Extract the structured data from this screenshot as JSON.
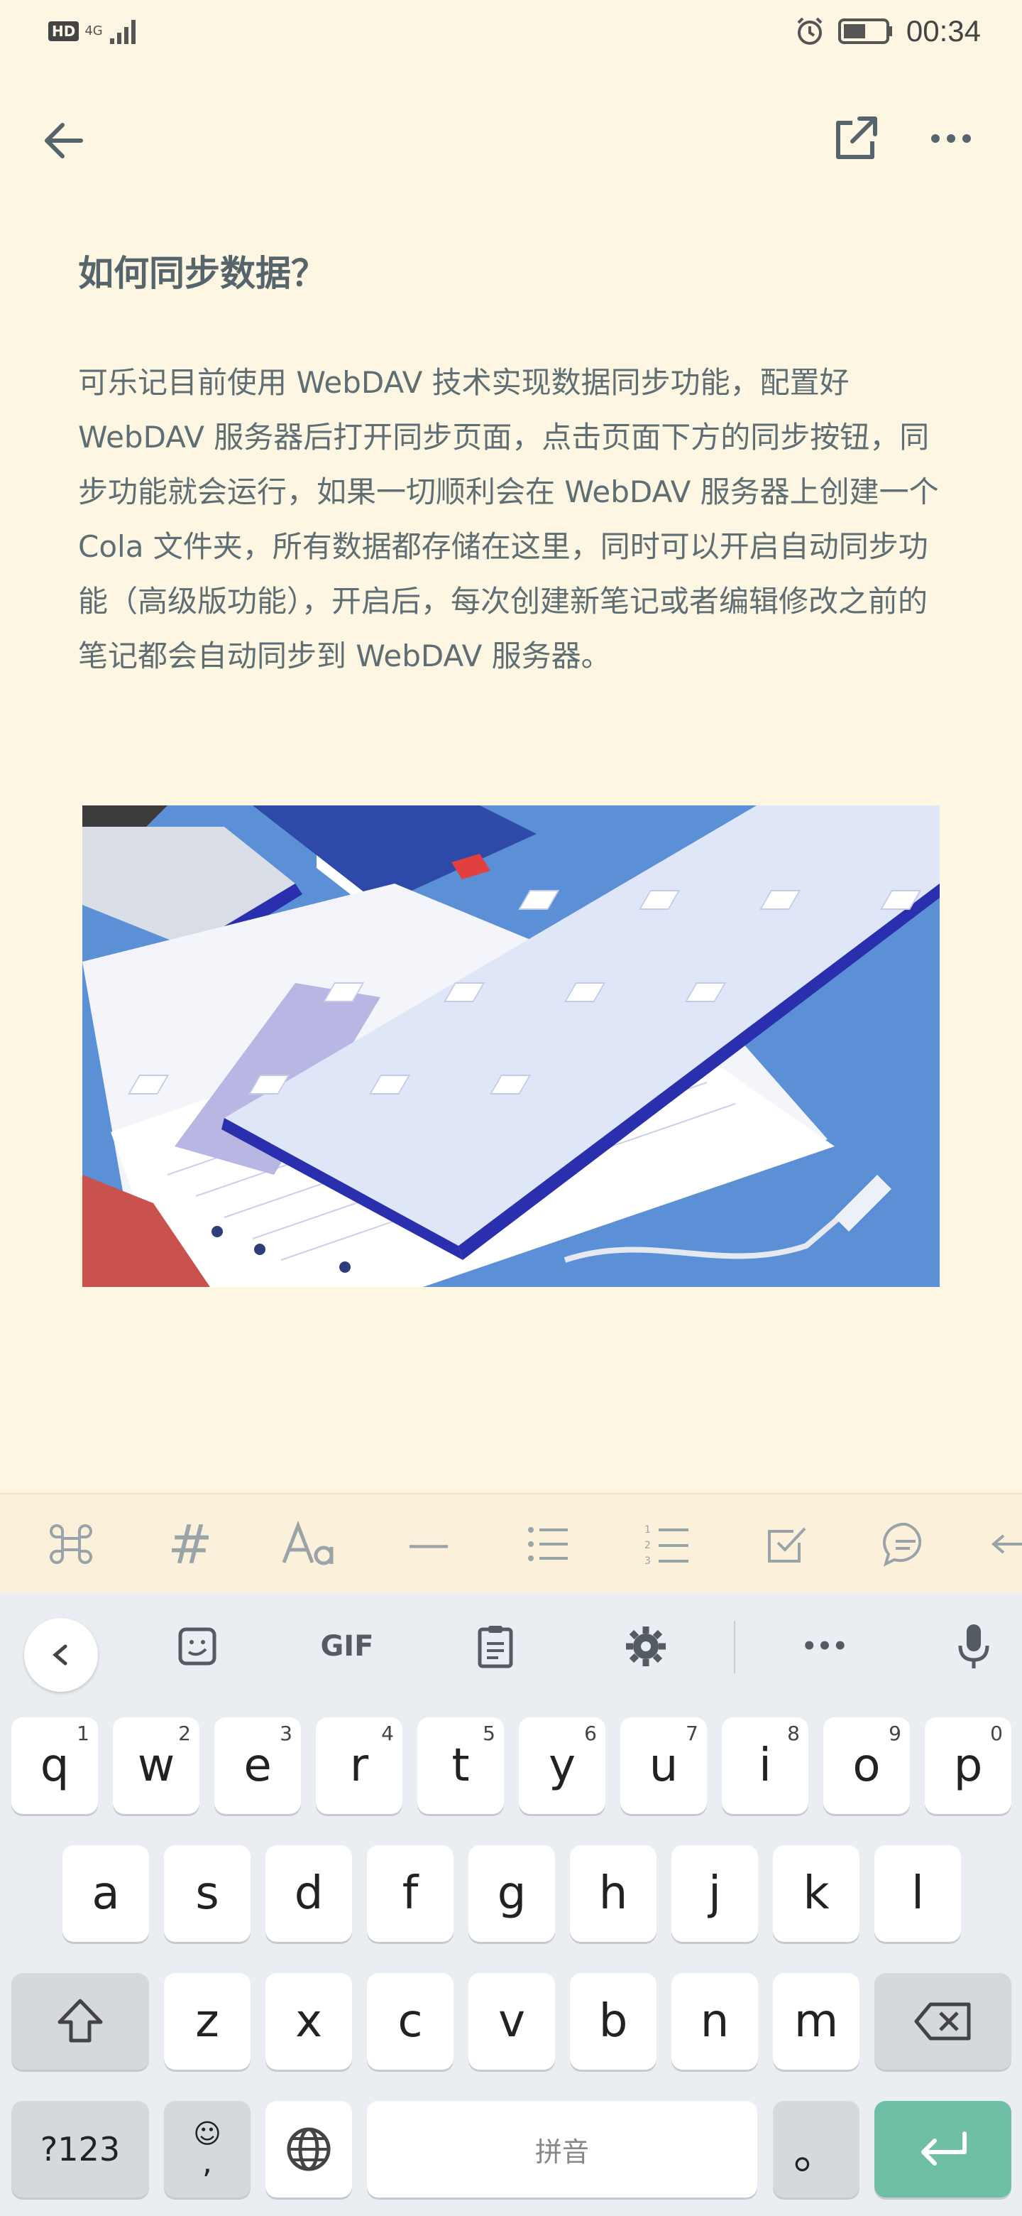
{
  "status_bar": {
    "left_badge": "HD",
    "network": "4G",
    "time": "00:34"
  },
  "note": {
    "title": "如何同步数据？",
    "body": "可乐记目前使用 WebDAV 技术实现数据同步功能，配置好 WebDAV 服务器后打开同步页面，点击页面下方的同步按钮，同步功能就会运行，如果一切顺利会在 WebDAV 服务器上创建一个 Cola 文件夹，所有数据都存储在这里，同时可以开启自动同步功能（高级版功能），开启后，每次创建新笔记或者编辑修改之前的笔记都会自动同步到 WebDAV 服务器。",
    "image_alt": "Illustration of a keyboard on a desk with notes"
  },
  "markdown_toolbar": {
    "tools": [
      "command-icon",
      "heading-icon",
      "text-format-icon",
      "divider-icon",
      "bullet-list-icon",
      "numbered-list-icon",
      "checkbox-icon",
      "quote-icon",
      "more-tools-icon"
    ],
    "heading_glyph": "#",
    "divider_glyph": "—"
  },
  "keyboard": {
    "toolbar": {
      "gif_label": "GIF",
      "more_label": "•••"
    },
    "row1": [
      {
        "label": "q",
        "num": "1"
      },
      {
        "label": "w",
        "num": "2"
      },
      {
        "label": "e",
        "num": "3"
      },
      {
        "label": "r",
        "num": "4"
      },
      {
        "label": "t",
        "num": "5"
      },
      {
        "label": "y",
        "num": "6"
      },
      {
        "label": "u",
        "num": "7"
      },
      {
        "label": "i",
        "num": "8"
      },
      {
        "label": "o",
        "num": "9"
      },
      {
        "label": "p",
        "num": "0"
      }
    ],
    "row2": [
      "a",
      "s",
      "d",
      "f",
      "g",
      "h",
      "j",
      "k",
      "l"
    ],
    "row3": [
      "z",
      "x",
      "c",
      "v",
      "b",
      "n",
      "m"
    ],
    "sym_label": "?123",
    "emoji_label": "☺",
    "comma_label": ",",
    "space_label": "拼音",
    "period_label": "。"
  }
}
